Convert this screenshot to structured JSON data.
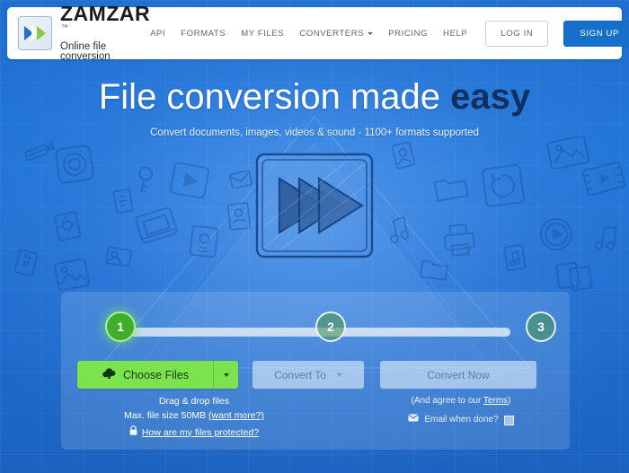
{
  "header": {
    "logo_icon": "zamzar-chevrons-logo-icon",
    "brand_name": "ZAMZAR",
    "brand_tm": "™",
    "brand_tagline": "Online file conversion",
    "nav": [
      {
        "label": "API",
        "has_caret": false
      },
      {
        "label": "FORMATS",
        "has_caret": false
      },
      {
        "label": "MY FILES",
        "has_caret": false
      },
      {
        "label": "CONVERTERS",
        "has_caret": true
      },
      {
        "label": "PRICING",
        "has_caret": false
      },
      {
        "label": "HELP",
        "has_caret": false
      }
    ],
    "login_label": "LOG IN",
    "signup_label": "SIGN UP"
  },
  "hero": {
    "headline_plain": "File conversion made ",
    "headline_accent": "easy",
    "subhead": "Convert documents, images, videos & sound - 1100+ formats supported"
  },
  "panel": {
    "steps": [
      {
        "number": "1",
        "state": "active"
      },
      {
        "number": "2",
        "state": "inactive"
      },
      {
        "number": "3",
        "state": "inactive"
      }
    ],
    "choose_files": {
      "label": "Choose Files",
      "icon": "cloud-upload-icon",
      "split_icon": "caret-down-icon"
    },
    "convert_to": {
      "label": "Convert To",
      "icon": "caret-down-icon"
    },
    "convert_now": {
      "label": "Convert Now"
    },
    "info_left": {
      "drag_drop": "Drag & drop files",
      "max_size_text": "Max. file size 50MB ",
      "want_more_link": "(want more?)",
      "lock_icon": "padlock-icon",
      "protected_link": "How are my files protected?"
    },
    "info_right": {
      "agree_text": "(And agree to our ",
      "terms_link": "Terms",
      "agree_text_end": ")",
      "email_icon": "envelope-icon",
      "email_label": "Email when done?",
      "checkbox_state": "unchecked"
    }
  },
  "colors": {
    "page_blue": "#1f6fd0",
    "signup_blue": "#1670cb",
    "choose_green": "#7ce34e",
    "step_active_green": "#3fae2a",
    "accent_navy": "#11305f",
    "panel_overlay": "rgba(255,255,255,0.14)"
  },
  "graphics": {
    "centre_icon": "sketched-play-triangles-icon",
    "background_icons": [
      "pencil-icon",
      "camera-lens-icon",
      "key-icon",
      "video-play-icon",
      "mail-icon",
      "text-file-icon",
      "settings-file-icon",
      "presentation-icon",
      "image-card-icon",
      "picture-file-icon",
      "contact-card-icon",
      "photo-frame-icon",
      "folder-icon",
      "refresh-disc-icon",
      "play-circle-icon",
      "film-strip-icon",
      "music-note-icon",
      "printer-icon",
      "audio-file-icon",
      "copy-files-icon",
      "archive-icon"
    ]
  }
}
